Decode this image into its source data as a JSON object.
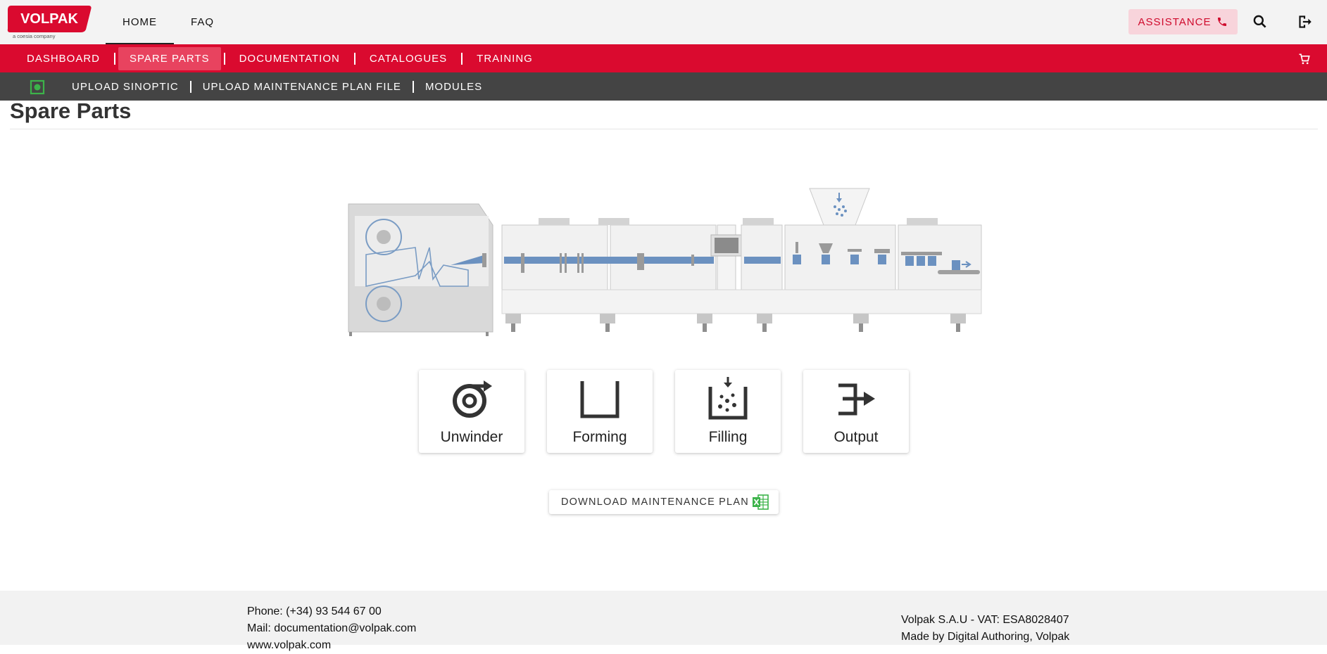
{
  "brand": {
    "logo_text": "VOLPAK",
    "tagline": "a coesia company",
    "accent": "#da0a2f"
  },
  "topnav": {
    "items": [
      {
        "label": "HOME",
        "active": true
      },
      {
        "label": "FAQ",
        "active": false
      }
    ]
  },
  "assistance": {
    "label": "ASSISTANCE",
    "icon": "phone-icon"
  },
  "header_icons": [
    "search-icon",
    "logout-icon"
  ],
  "main_nav": {
    "items": [
      {
        "label": "DASHBOARD",
        "active": false
      },
      {
        "label": "SPARE PARTS",
        "active": true
      },
      {
        "label": "DOCUMENTATION",
        "active": false
      },
      {
        "label": "CATALOGUES",
        "active": false
      },
      {
        "label": "TRAINING",
        "active": false
      }
    ],
    "cart_icon": "cart-icon"
  },
  "sub_nav": {
    "items": [
      "UPLOAD SINOPTIC",
      "UPLOAD MAINTENANCE PLAN FILE",
      "MODULES"
    ]
  },
  "page_title": "Spare Parts",
  "modules": [
    {
      "label": "Unwinder",
      "icon": "unwinder-icon"
    },
    {
      "label": "Forming",
      "icon": "forming-icon"
    },
    {
      "label": "Filling",
      "icon": "filling-icon"
    },
    {
      "label": "Output",
      "icon": "output-icon"
    }
  ],
  "download_button": {
    "label": "DOWNLOAD MAINTENANCE PLAN",
    "icon": "excel-icon"
  },
  "footer": {
    "left": [
      "Phone: (+34) 93 544 67 00",
      "Mail: documentation@volpak.com",
      "www.volpak.com"
    ],
    "right": [
      "Volpak S.A.U - VAT: ESA8028407",
      "Made by Digital Authoring, Volpak"
    ]
  }
}
